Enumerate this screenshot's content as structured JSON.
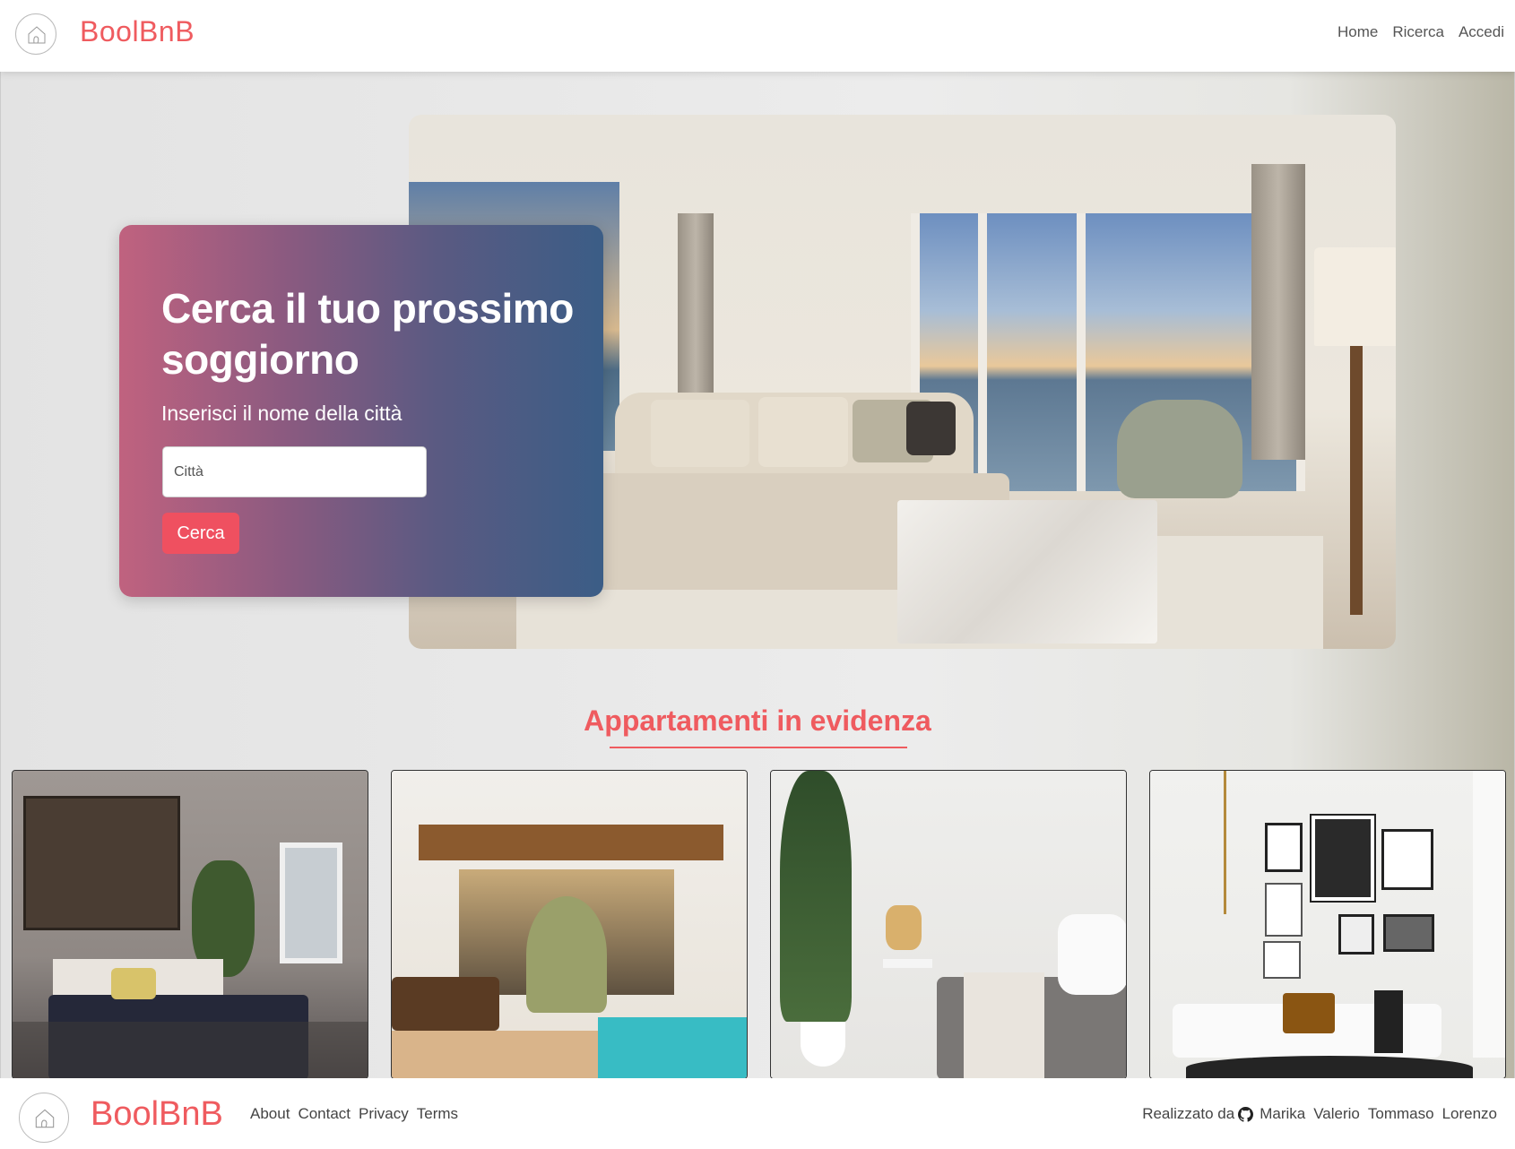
{
  "header": {
    "brand": "BoolBnB",
    "nav": [
      "Home",
      "Ricerca",
      "Accedi"
    ]
  },
  "hero": {
    "title": "Cerca il tuo prossimo soggiorno",
    "subtitle": "Inserisci il nome della città",
    "input_placeholder": "Città",
    "button_label": "Cerca"
  },
  "featured": {
    "title": "Appartamenti in evidenza",
    "cards": [
      {
        "icon": "bedroom-photo"
      },
      {
        "icon": "patio-pool-photo"
      },
      {
        "icon": "plants-living-photo"
      },
      {
        "icon": "gallery-wall-living-photo"
      }
    ]
  },
  "footer": {
    "brand": "BoolBnB",
    "links": [
      "About",
      "Contact",
      "Privacy",
      "Terms"
    ],
    "credits_label": "Realizzato da",
    "authors": [
      "Marika",
      "Valerio",
      "Tommaso",
      "Lorenzo"
    ]
  },
  "colors": {
    "brand": "#ef5b5f",
    "button": "#ef5060",
    "card_gradient_start": "#c0627f",
    "card_gradient_end": "#3b5d86"
  }
}
